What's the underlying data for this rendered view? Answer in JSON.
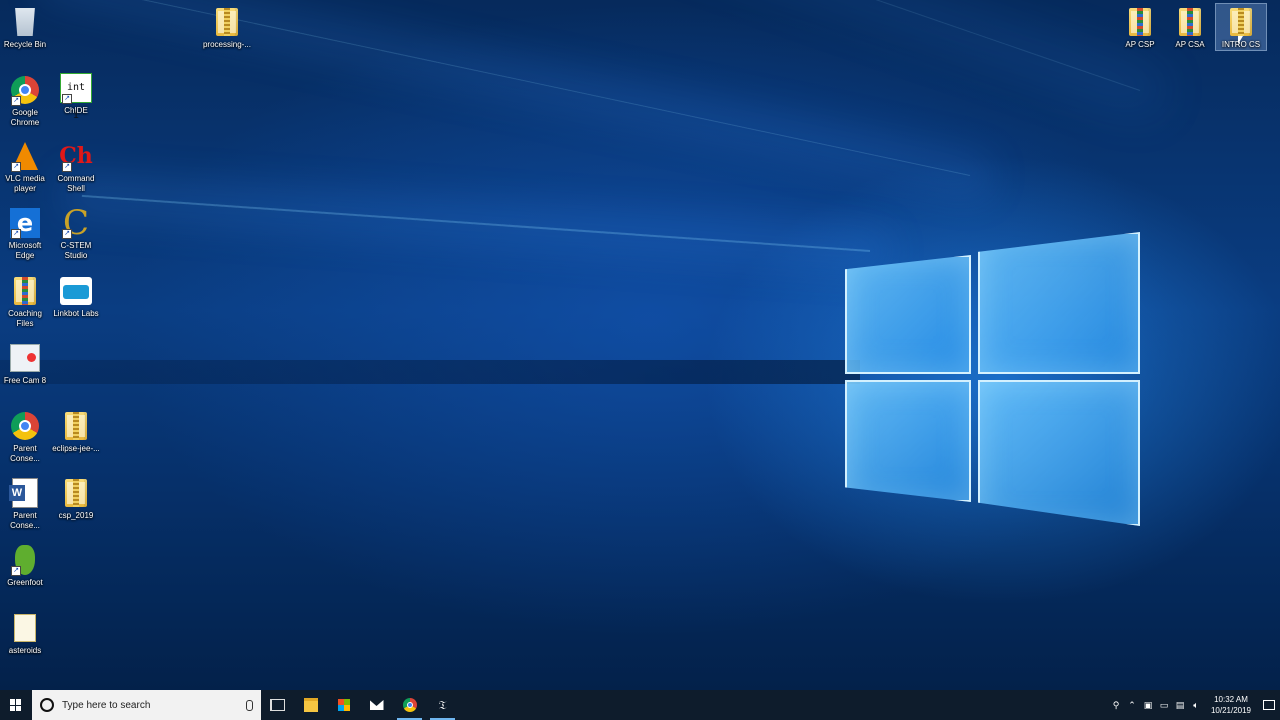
{
  "desktop": {
    "icons": {
      "recycle_bin": "Recycle Bin",
      "processing": "processing-...",
      "google_chrome": "Google Chrome",
      "chide": "ChIDE",
      "vlc": "VLC media player",
      "command_shell": "Command Shell",
      "microsoft_edge": "Microsoft Edge",
      "cstem_studio": "C-STEM Studio",
      "coaching_files": "Coaching Files",
      "linkbot_labs": "Linkbot Labs",
      "free_cam": "Free Cam 8",
      "parent_conse_chrome": "Parent Conse...",
      "eclipse": "eclipse-jee-...",
      "parent_conse_word": "Parent Conse...",
      "csp_2019": "csp_2019",
      "greenfoot": "Greenfoot",
      "asteroids": "asteroids",
      "ap_csp": "AP CSP",
      "ap_csa": "AP CSA",
      "intro_cs": "INTRO CS"
    },
    "icon_glyphs": {
      "chide_text": "int i",
      "command_shell_text": "Ch",
      "edge_text": "e",
      "cstem_text": "C"
    }
  },
  "taskbar": {
    "search_placeholder": "Type here to search",
    "pinned": [
      "task-view",
      "file-explorer",
      "microsoft-store",
      "mail",
      "google-chrome",
      "chide-app"
    ],
    "tray": {
      "time": "10:32 AM",
      "date": "10/21/2019"
    }
  },
  "colors": {
    "taskbar_bg": "#0e1c2c",
    "accent": "#1570d6",
    "active_indicator": "#6fb6f0"
  }
}
